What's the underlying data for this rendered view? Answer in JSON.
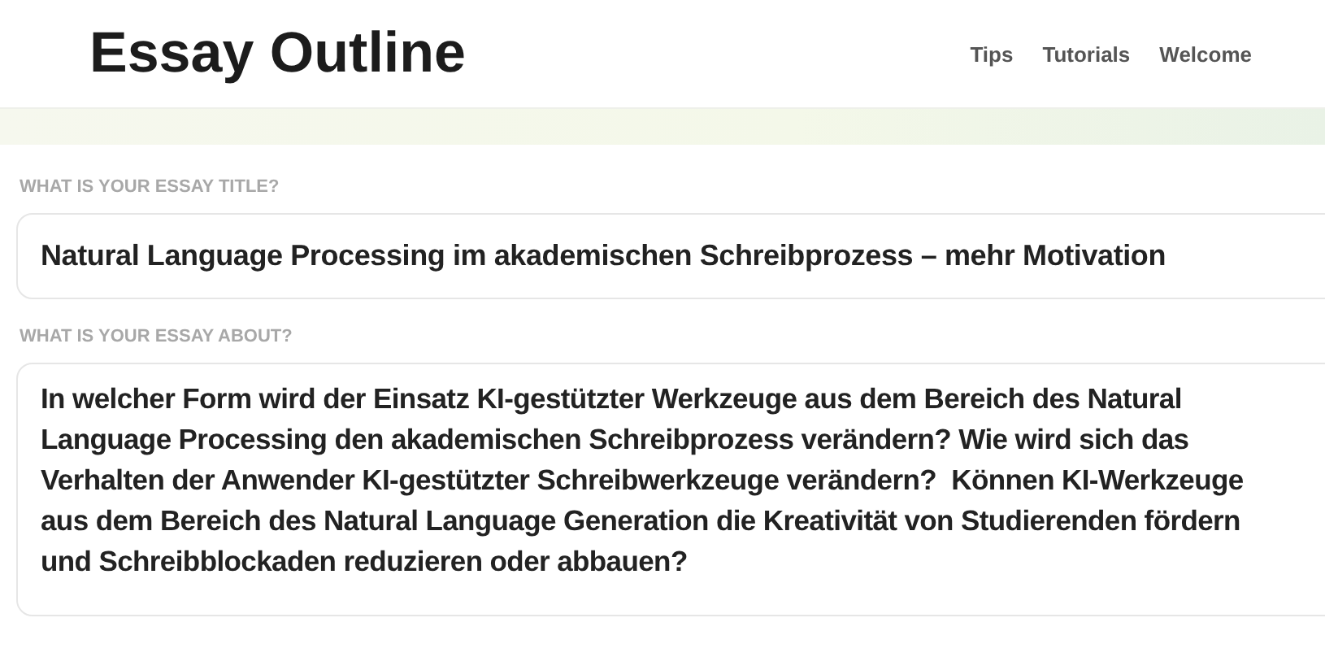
{
  "header": {
    "title": "Essay Outline",
    "nav": [
      "Tips",
      "Tutorials",
      "Welcome"
    ]
  },
  "fields": [
    {
      "kind": "input",
      "label": "WHAT IS YOUR ESSAY TITLE?",
      "value": "Natural Language Processing im akademischen Schreibprozess – mehr Motivation"
    },
    {
      "kind": "textarea",
      "label": "WHAT IS YOUR ESSAY ABOUT?",
      "value": "In welcher Form wird der Einsatz KI-gestützter Werkzeuge aus dem Bereich des Natural Language Processing den akademischen Schreibprozess verändern? Wie wird sich das Verhalten der Anwender KI-gestützter Schreibwerkzeuge verändern?  Können KI-Werkzeuge aus dem Bereich des Natural Language Generation die Kreativität von Studierenden fördern und Schreibblockaden reduzieren oder abbauen?"
    }
  ]
}
